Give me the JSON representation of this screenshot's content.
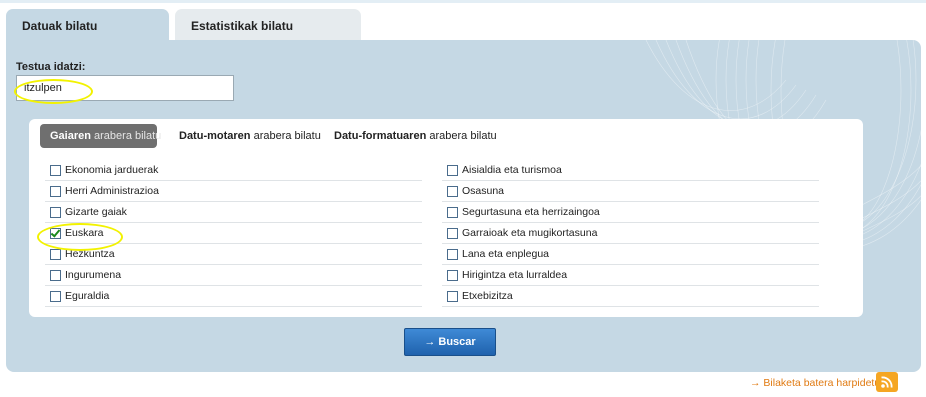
{
  "tabs": [
    {
      "label": "Datuak bilatu",
      "active": true
    },
    {
      "label": "Estatistikak bilatu",
      "active": false
    }
  ],
  "search": {
    "label": "Testua idatzi:",
    "value": "itzulpen"
  },
  "filter_tabs": [
    {
      "bold": "Gaiaren",
      "rest": " arabera bilatu",
      "active": true
    },
    {
      "bold": "Datu-motaren",
      "rest": " arabera bilatu",
      "active": false
    },
    {
      "bold": "Datu-formatuaren",
      "rest": " arabera bilatu",
      "active": false
    }
  ],
  "topics_left": [
    {
      "label": "Ekonomia jarduerak",
      "checked": false
    },
    {
      "label": "Herri Administrazioa",
      "checked": false
    },
    {
      "label": "Gizarte gaiak",
      "checked": false
    },
    {
      "label": "Euskara",
      "checked": true
    },
    {
      "label": "Hezkuntza",
      "checked": false
    },
    {
      "label": "Ingurumena",
      "checked": false
    },
    {
      "label": "Eguraldia",
      "checked": false
    }
  ],
  "topics_right": [
    {
      "label": "Aisialdia eta turismoa",
      "checked": false
    },
    {
      "label": "Osasuna",
      "checked": false
    },
    {
      "label": "Segurtasuna eta herrizaingoa",
      "checked": false
    },
    {
      "label": "Garraioak eta mugikortasuna",
      "checked": false
    },
    {
      "label": "Lana eta enplegua",
      "checked": false
    },
    {
      "label": "Hirigintza eta lurraldea",
      "checked": false
    },
    {
      "label": "Etxebizitza",
      "checked": false
    }
  ],
  "search_button": "→ Buscar",
  "subscribe_link": "→ Bilaketa batera harpidetu",
  "icons": {
    "rss": "rss-icon",
    "check": "checkmark-icon"
  },
  "colors": {
    "panel": "#c5d8e4",
    "button": "#1f62ad",
    "link": "#e07a12",
    "rss": "#f5a623",
    "highlight": "#f2f200"
  }
}
